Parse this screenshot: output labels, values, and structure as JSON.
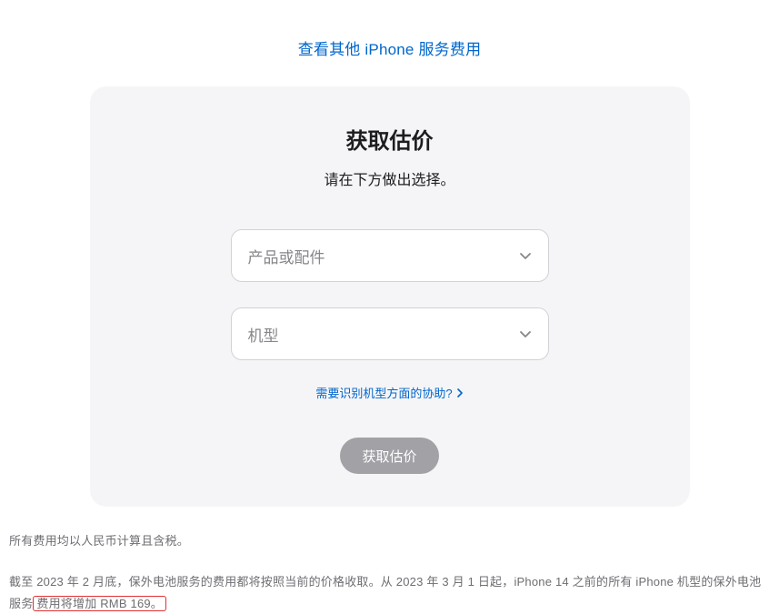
{
  "header": {
    "link_label": "查看其他 iPhone 服务费用"
  },
  "card": {
    "title": "获取估价",
    "subtitle": "请在下方做出选择。",
    "select_product_placeholder": "产品或配件",
    "select_model_placeholder": "机型",
    "help_link": "需要识别机型方面的协助?",
    "submit_label": "获取估价"
  },
  "footnotes": {
    "line1": "所有费用均以人民币计算且含税。",
    "line2_prefix": "截至 2023 年 2 月底，保外电池服务的费用都将按照当前的价格收取。从 2023 年 3 月 1 日起，iPhone 14 之前的所有 iPhone 机型的保外电池服务",
    "line2_highlight": "费用将增加 RMB 169。"
  }
}
